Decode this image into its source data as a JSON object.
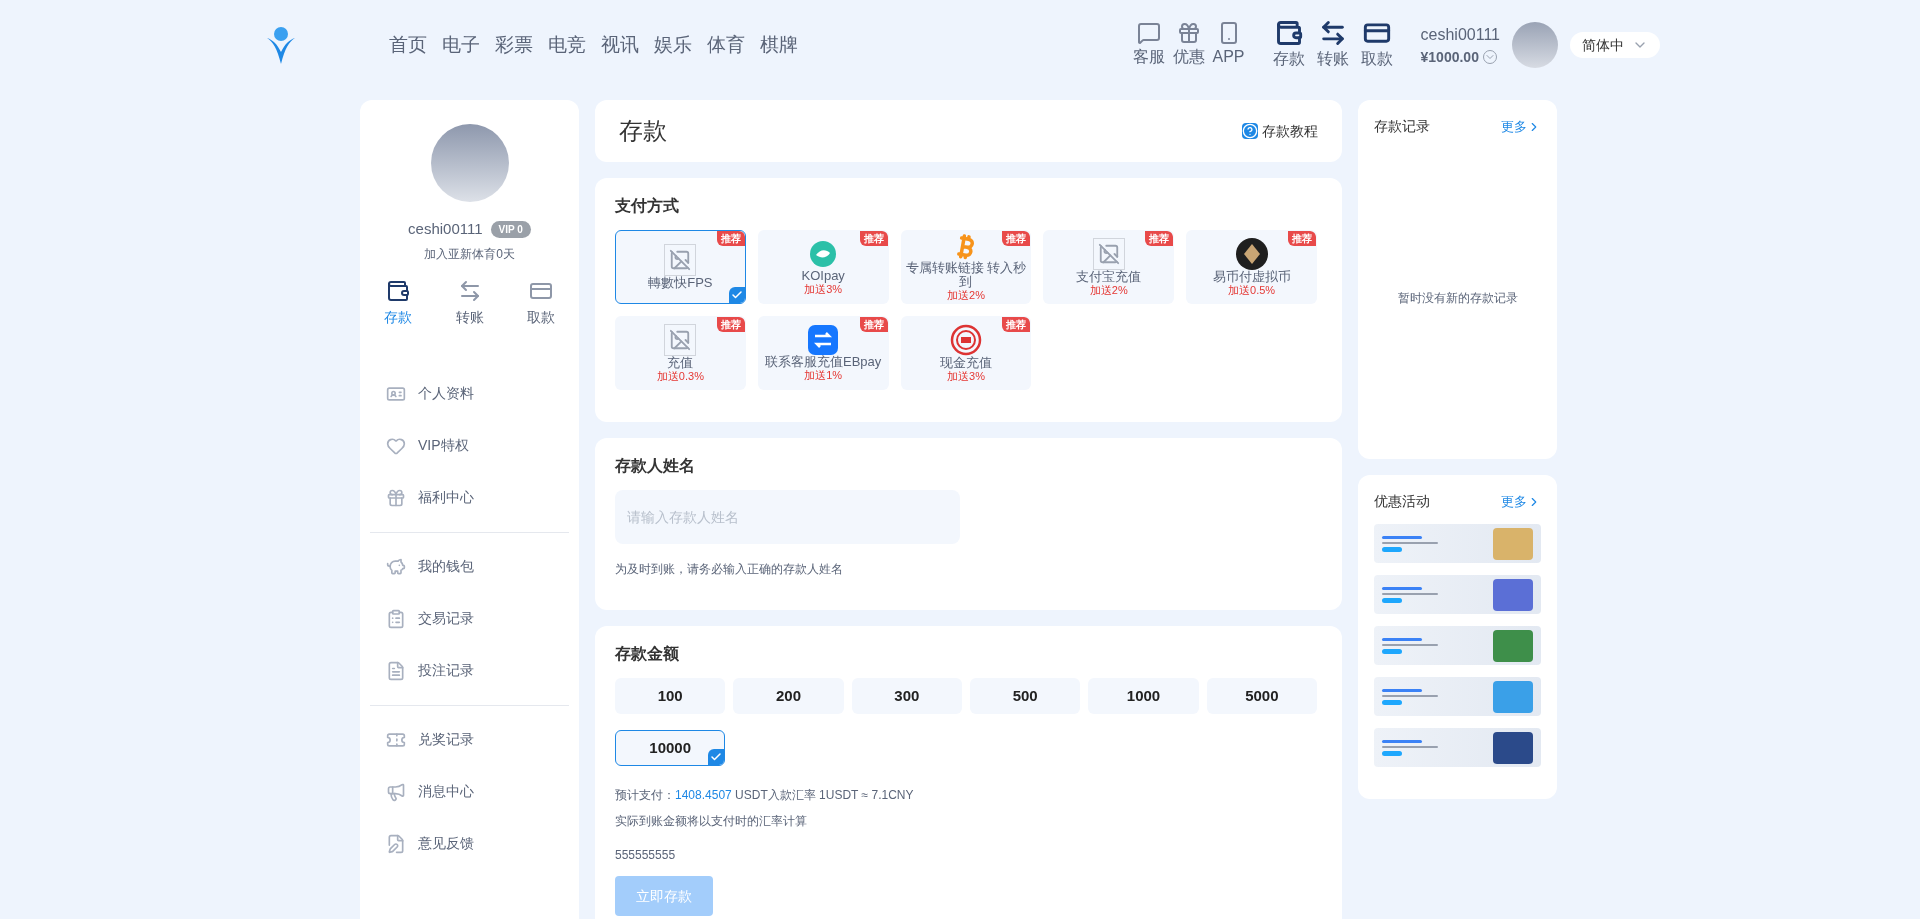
{
  "header": {
    "nav": [
      {
        "label": "首页"
      },
      {
        "label": "电子"
      },
      {
        "label": "彩票"
      },
      {
        "label": "电竞"
      },
      {
        "label": "视讯"
      },
      {
        "label": "娱乐"
      },
      {
        "label": "体育"
      },
      {
        "label": "棋牌"
      }
    ],
    "services": [
      {
        "kind": "chat",
        "label": "客服"
      },
      {
        "kind": "gift",
        "label": "优惠"
      },
      {
        "kind": "phone",
        "label": "APP"
      }
    ],
    "wallet_actions": [
      {
        "kind": "deposit",
        "label": "存款"
      },
      {
        "kind": "transfer",
        "label": "转账"
      },
      {
        "kind": "withdraw",
        "label": "取款"
      }
    ],
    "user": {
      "username": "ceshi00111",
      "balance": "¥1000.00"
    },
    "language": "简体中"
  },
  "sidebar": {
    "username": "ceshi00111",
    "vip": "VIP 0",
    "joined": "加入亚新体育0天",
    "quick_actions": [
      {
        "kind": "deposit",
        "label": "存款",
        "selected": true
      },
      {
        "kind": "transfer",
        "label": "转账",
        "selected": false
      },
      {
        "kind": "withdraw",
        "label": "取款",
        "selected": false
      }
    ],
    "menu_groups": [
      [
        {
          "kind": "profile",
          "label": "个人资料"
        },
        {
          "kind": "vip",
          "label": "VIP特权"
        },
        {
          "kind": "gift",
          "label": "福利中心"
        }
      ],
      [
        {
          "kind": "wallet",
          "label": "我的钱包"
        },
        {
          "kind": "transactions",
          "label": "交易记录"
        },
        {
          "kind": "bets",
          "label": "投注记录"
        }
      ],
      [
        {
          "kind": "ticket",
          "label": "兑奖记录"
        },
        {
          "kind": "megaphone",
          "label": "消息中心"
        },
        {
          "kind": "feedback",
          "label": "意见反馈"
        }
      ]
    ]
  },
  "main": {
    "title": "存款",
    "tutorial": "存款教程",
    "payment": {
      "title": "支付方式",
      "methods": [
        {
          "kind": "broken",
          "name": "轉數快FPS",
          "badge": "推荐",
          "selected": true
        },
        {
          "kind": "koi",
          "name": "KOIpay",
          "bonus": "加送3%",
          "badge": "推荐",
          "selected": false
        },
        {
          "kind": "bitcoin",
          "name": "专属转账链接 转入秒到",
          "bonus": "加送2%",
          "badge": "推荐",
          "selected": false
        },
        {
          "kind": "broken",
          "name": "支付宝充值",
          "bonus": "加送2%",
          "badge": "推荐",
          "selected": false
        },
        {
          "kind": "coin",
          "name": "易币付虚拟币",
          "bonus": "加送0.5%",
          "badge": "推荐",
          "selected": false
        },
        {
          "kind": "broken",
          "name": "充值",
          "bonus": "加送0.3%",
          "badge": "推荐",
          "selected": false
        },
        {
          "kind": "eb",
          "name": "联系客服充值EBpay",
          "bonus": "加送1%",
          "badge": "推荐",
          "selected": false
        },
        {
          "kind": "cash",
          "name": "现金充值",
          "bonus": "加送3%",
          "badge": "推荐",
          "selected": false
        }
      ]
    },
    "depositor": {
      "title": "存款人姓名",
      "placeholder": "请输入存款人姓名",
      "hint": "为及时到账，请务必输入正确的存款人姓名"
    },
    "amount": {
      "title": "存款金额",
      "options": [
        {
          "label": "100",
          "selected": false
        },
        {
          "label": "200",
          "selected": false
        },
        {
          "label": "300",
          "selected": false
        },
        {
          "label": "500",
          "selected": false
        },
        {
          "label": "1000",
          "selected": false
        },
        {
          "label": "5000",
          "selected": false
        },
        {
          "label": "10000",
          "selected": true
        }
      ],
      "estimate_label": "预计支付：",
      "estimate_value": "1408.4507",
      "estimate_rate": "USDT入款汇率 1USDT ≈ 7.1CNY",
      "note": "实际到账金额将以支付时的汇率计算",
      "extra": "555555555",
      "submit": {
        "label": "立即存款",
        "disabled": true
      }
    }
  },
  "right": {
    "records": {
      "title": "存款记录",
      "more": "更多",
      "empty": "暂时没有新的存款记录"
    },
    "promos": {
      "title": "优惠活动",
      "more": "更多",
      "banners": [
        {
          "kind": "casino"
        },
        {
          "kind": "slots"
        },
        {
          "kind": "sports"
        },
        {
          "kind": "lottery"
        },
        {
          "kind": "welfare"
        }
      ]
    }
  }
}
